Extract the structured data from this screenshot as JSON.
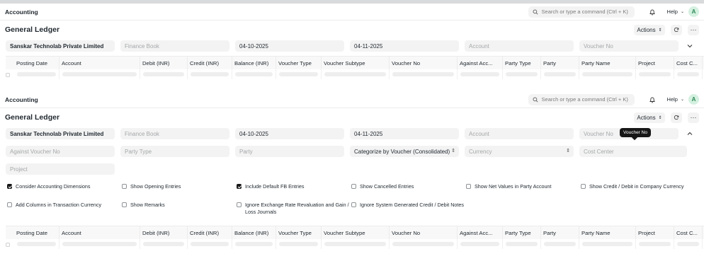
{
  "app": {
    "breadcrumb": "Accounting",
    "search_placeholder": "Search or type a command (Ctrl + K)",
    "help_label": "Help",
    "avatar_initial": "A"
  },
  "page": {
    "title": "General Ledger",
    "actions_label": "Actions"
  },
  "filters": {
    "company": "Sanskar Technolab Private Limited",
    "finance_book": "Finance Book",
    "from_date": "04-10-2025",
    "to_date": "04-11-2025",
    "account": "Account",
    "voucher_no": "Voucher No",
    "against_voucher_no": "Against Voucher No",
    "party_type": "Party Type",
    "party": "Party",
    "categorize_by": "Categorize by Voucher (Consolidated)",
    "currency": "Currency",
    "cost_center": "Cost Center",
    "project": "Project"
  },
  "checkboxes": [
    {
      "label": "Consider Accounting Dimensions",
      "checked": true
    },
    {
      "label": "Show Opening Entries",
      "checked": false
    },
    {
      "label": "Include Default FB Entries",
      "checked": true
    },
    {
      "label": "Show Cancelled Entries",
      "checked": false
    },
    {
      "label": "Show Net Values in Party Account",
      "checked": false
    },
    {
      "label": "Show Credit / Debit in Company Currency",
      "checked": false
    },
    {
      "label": "Add Columns in Transaction Currency",
      "checked": false
    },
    {
      "label": "Show Remarks",
      "checked": false
    },
    {
      "label": "Ignore Exchange Rate Revaluation and Gain / Loss Journals",
      "checked": false
    },
    {
      "label": "Ignore System Generated Credit / Debit Notes",
      "checked": false
    }
  ],
  "columns": [
    "Posting Date",
    "Account",
    "Debit (INR)",
    "Credit (INR)",
    "Balance (INR)",
    "Voucher Type",
    "Voucher Subtype",
    "Voucher No",
    "Against Acc...",
    "Party Type",
    "Party",
    "Party Name",
    "Project",
    "Cost C..."
  ],
  "tooltip": "Voucher No",
  "colors": {
    "accent_dark": "#171717",
    "field_bg": "#f3f3f3",
    "avatar_bg": "#d4f0e0",
    "avatar_fg": "#2d8a56"
  }
}
